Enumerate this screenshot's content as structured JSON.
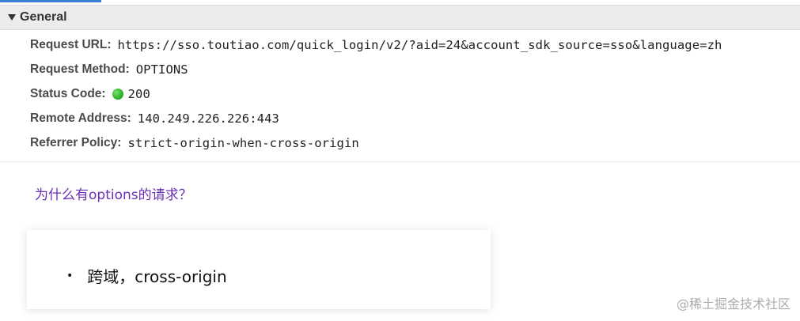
{
  "devtools": {
    "section_title": "General",
    "rows": [
      {
        "key": "Request URL:",
        "value": "https://sso.toutiao.com/quick_login/v2/?aid=24&account_sdk_source=sso&language=zh"
      },
      {
        "key": "Request Method:",
        "value": "OPTIONS"
      },
      {
        "key": "Status Code:",
        "value": "200",
        "status_color": "#2fb52a"
      },
      {
        "key": "Remote Address:",
        "value": "140.249.226.226:443"
      },
      {
        "key": "Referrer Policy:",
        "value": "strict-origin-when-cross-origin"
      }
    ]
  },
  "question": "为什么有options的请求？",
  "card": {
    "bullet_text": "跨域，cross-origin"
  },
  "watermark": "@稀土掘金技术社区",
  "colors": {
    "question": "#6a2fb5",
    "tab_indicator": "#3b7ed6",
    "header_bg": "#ececec"
  }
}
